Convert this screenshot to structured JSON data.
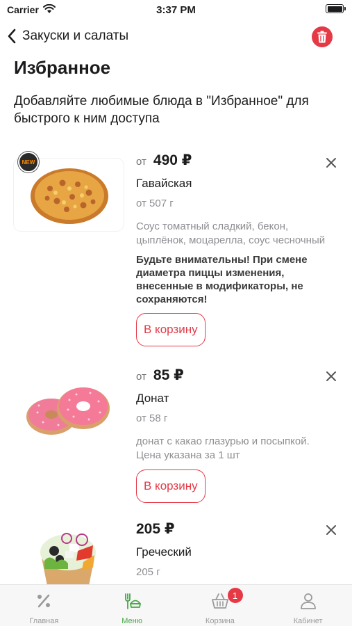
{
  "status_bar": {
    "carrier": "Carrier",
    "time": "3:37 PM"
  },
  "nav": {
    "back_label": "Закуски и салаты"
  },
  "page": {
    "title": "Избранное",
    "subtitle": "Добавляйте любимые блюда в \"Избранное\" для быстрого к ним доступа"
  },
  "items": [
    {
      "price_from": "от",
      "price": "490 ₽",
      "name": "Гавайская",
      "weight": "от 507 г",
      "description": "Соус томатный сладкий, бекон, цыплёнок, моцарелла, соус чесночный",
      "badge": "NEW",
      "warning": "Будьте внимательны! При смене диаметра пиццы изменения, внесенные в модификаторы, не сохраняются!",
      "button": "В корзину",
      "image_icon": "pizza-image"
    },
    {
      "price_from": "от",
      "price": "85 ₽",
      "name": "Донат",
      "weight": "от 58 г",
      "description": "донат с какао глазурью и посыпкой. Цена указана за 1 шт",
      "button": "В корзину",
      "image_icon": "donut-image"
    },
    {
      "price": "205 ₽",
      "name": "Греческий",
      "weight": "205 г",
      "image_icon": "salad-image"
    }
  ],
  "tab_bar": {
    "tabs": [
      {
        "label": "Главная",
        "icon": "percent-icon"
      },
      {
        "label": "Меню",
        "icon": "menu-food-icon",
        "active": true
      },
      {
        "label": "Корзина",
        "icon": "basket-icon",
        "badge": "1"
      },
      {
        "label": "Кабинет",
        "icon": "person-icon"
      }
    ]
  },
  "colors": {
    "accent": "#e53946",
    "active_tab": "#47a547"
  }
}
